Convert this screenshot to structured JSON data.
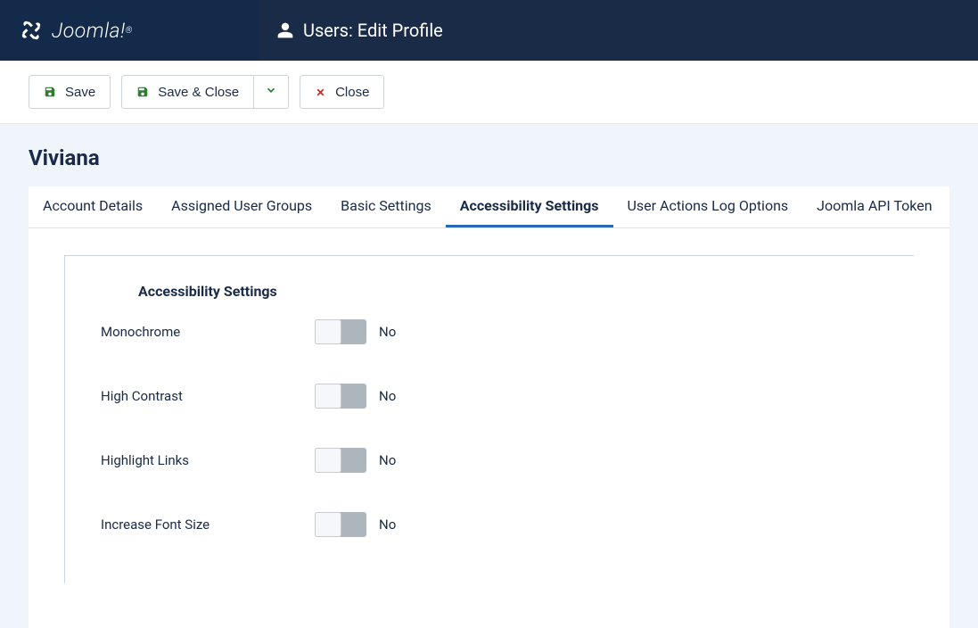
{
  "brand": "Joomla!",
  "header": {
    "title": "Users: Edit Profile"
  },
  "toolbar": {
    "save": "Save",
    "save_close": "Save & Close",
    "close": "Close"
  },
  "page_title": "Viviana",
  "tabs": [
    {
      "label": "Account Details",
      "active": false
    },
    {
      "label": "Assigned User Groups",
      "active": false
    },
    {
      "label": "Basic Settings",
      "active": false
    },
    {
      "label": "Accessibility Settings",
      "active": true
    },
    {
      "label": "User Actions Log Options",
      "active": false
    },
    {
      "label": "Joomla API Token",
      "active": false
    }
  ],
  "fieldset": {
    "legend": "Accessibility Settings",
    "rows": [
      {
        "label": "Monochrome",
        "state": "No"
      },
      {
        "label": "High Contrast",
        "state": "No"
      },
      {
        "label": "Highlight Links",
        "state": "No"
      },
      {
        "label": "Increase Font Size",
        "state": "No"
      }
    ]
  }
}
